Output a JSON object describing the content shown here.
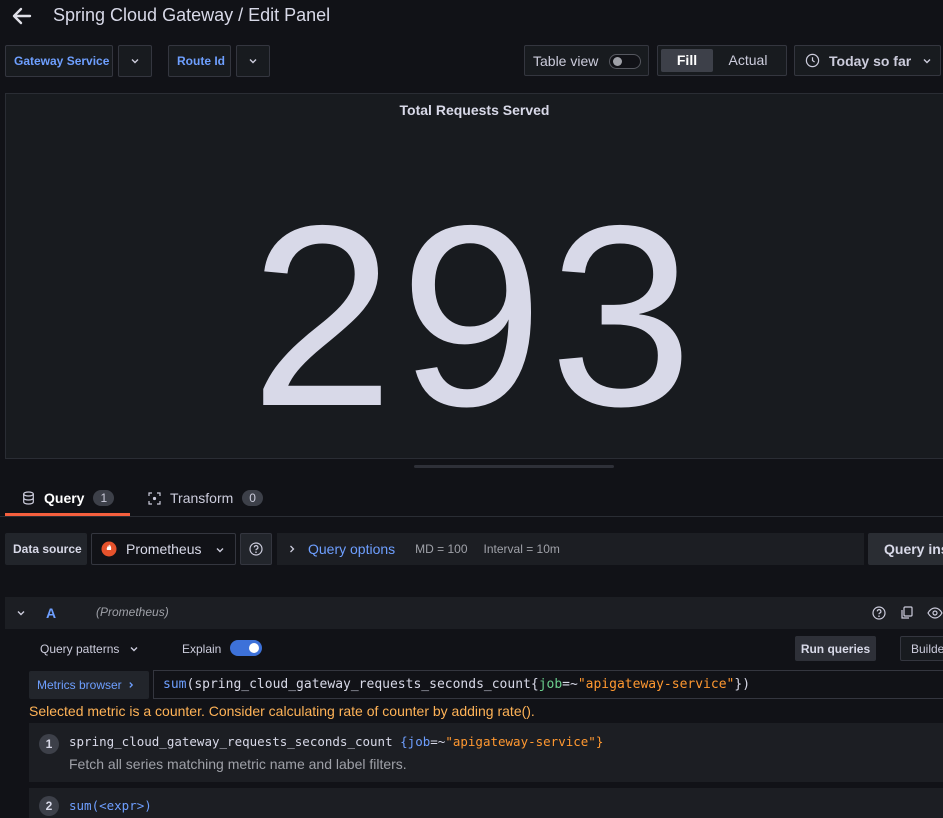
{
  "header": {
    "title": "Spring Cloud Gateway / Edit Panel"
  },
  "variables": [
    {
      "label": "Gateway Service",
      "value": ""
    },
    {
      "label": "Route Id",
      "value": ""
    }
  ],
  "toolbar": {
    "table_view_label": "Table view",
    "fill_label": "Fill",
    "actual_label": "Actual",
    "time_range_label": "Today so far"
  },
  "panel": {
    "title": "Total Requests Served",
    "value": "293"
  },
  "tabs": [
    {
      "label": "Query",
      "count": "1"
    },
    {
      "label": "Transform",
      "count": "0"
    }
  ],
  "datasource": {
    "label": "Data source",
    "selected": "Prometheus",
    "query_options_label": "Query options",
    "md": "MD = 100",
    "interval": "Interval = 10m",
    "query_inspector_label": "Query ins"
  },
  "query": {
    "ref_id": "A",
    "datasource_name": "(Prometheus)",
    "patterns_label": "Query patterns",
    "explain_label": "Explain",
    "run_label": "Run queries",
    "builder_label": "Builde",
    "metrics_browser_label": "Metrics browser",
    "expr_func": "sum",
    "expr_metric": "spring_cloud_gateway_requests_seconds_count",
    "expr_label_key": "job",
    "expr_op": "=~",
    "expr_label_value": "\"apigateway-service\"",
    "warning": "Selected metric is a counter. Consider calculating rate of counter by adding rate()."
  },
  "hints": [
    {
      "num": "1",
      "metric": "spring_cloud_gateway_requests_seconds_count",
      "label_key": "job",
      "op": "=~",
      "label_value": "\"apigateway-service\"",
      "description": "Fetch all series matching metric name and label filters."
    },
    {
      "num": "2",
      "text": "sum(<expr>)"
    }
  ],
  "colors": {
    "background": "#111217",
    "panel": "#181b1f",
    "accent_blue": "#6e9fff",
    "tab_underline": "#f55f3e",
    "warning": "#ffb357",
    "string": "#ff9830",
    "keyword": "#6ccf8e",
    "stat_text": "#d8d9e8"
  }
}
